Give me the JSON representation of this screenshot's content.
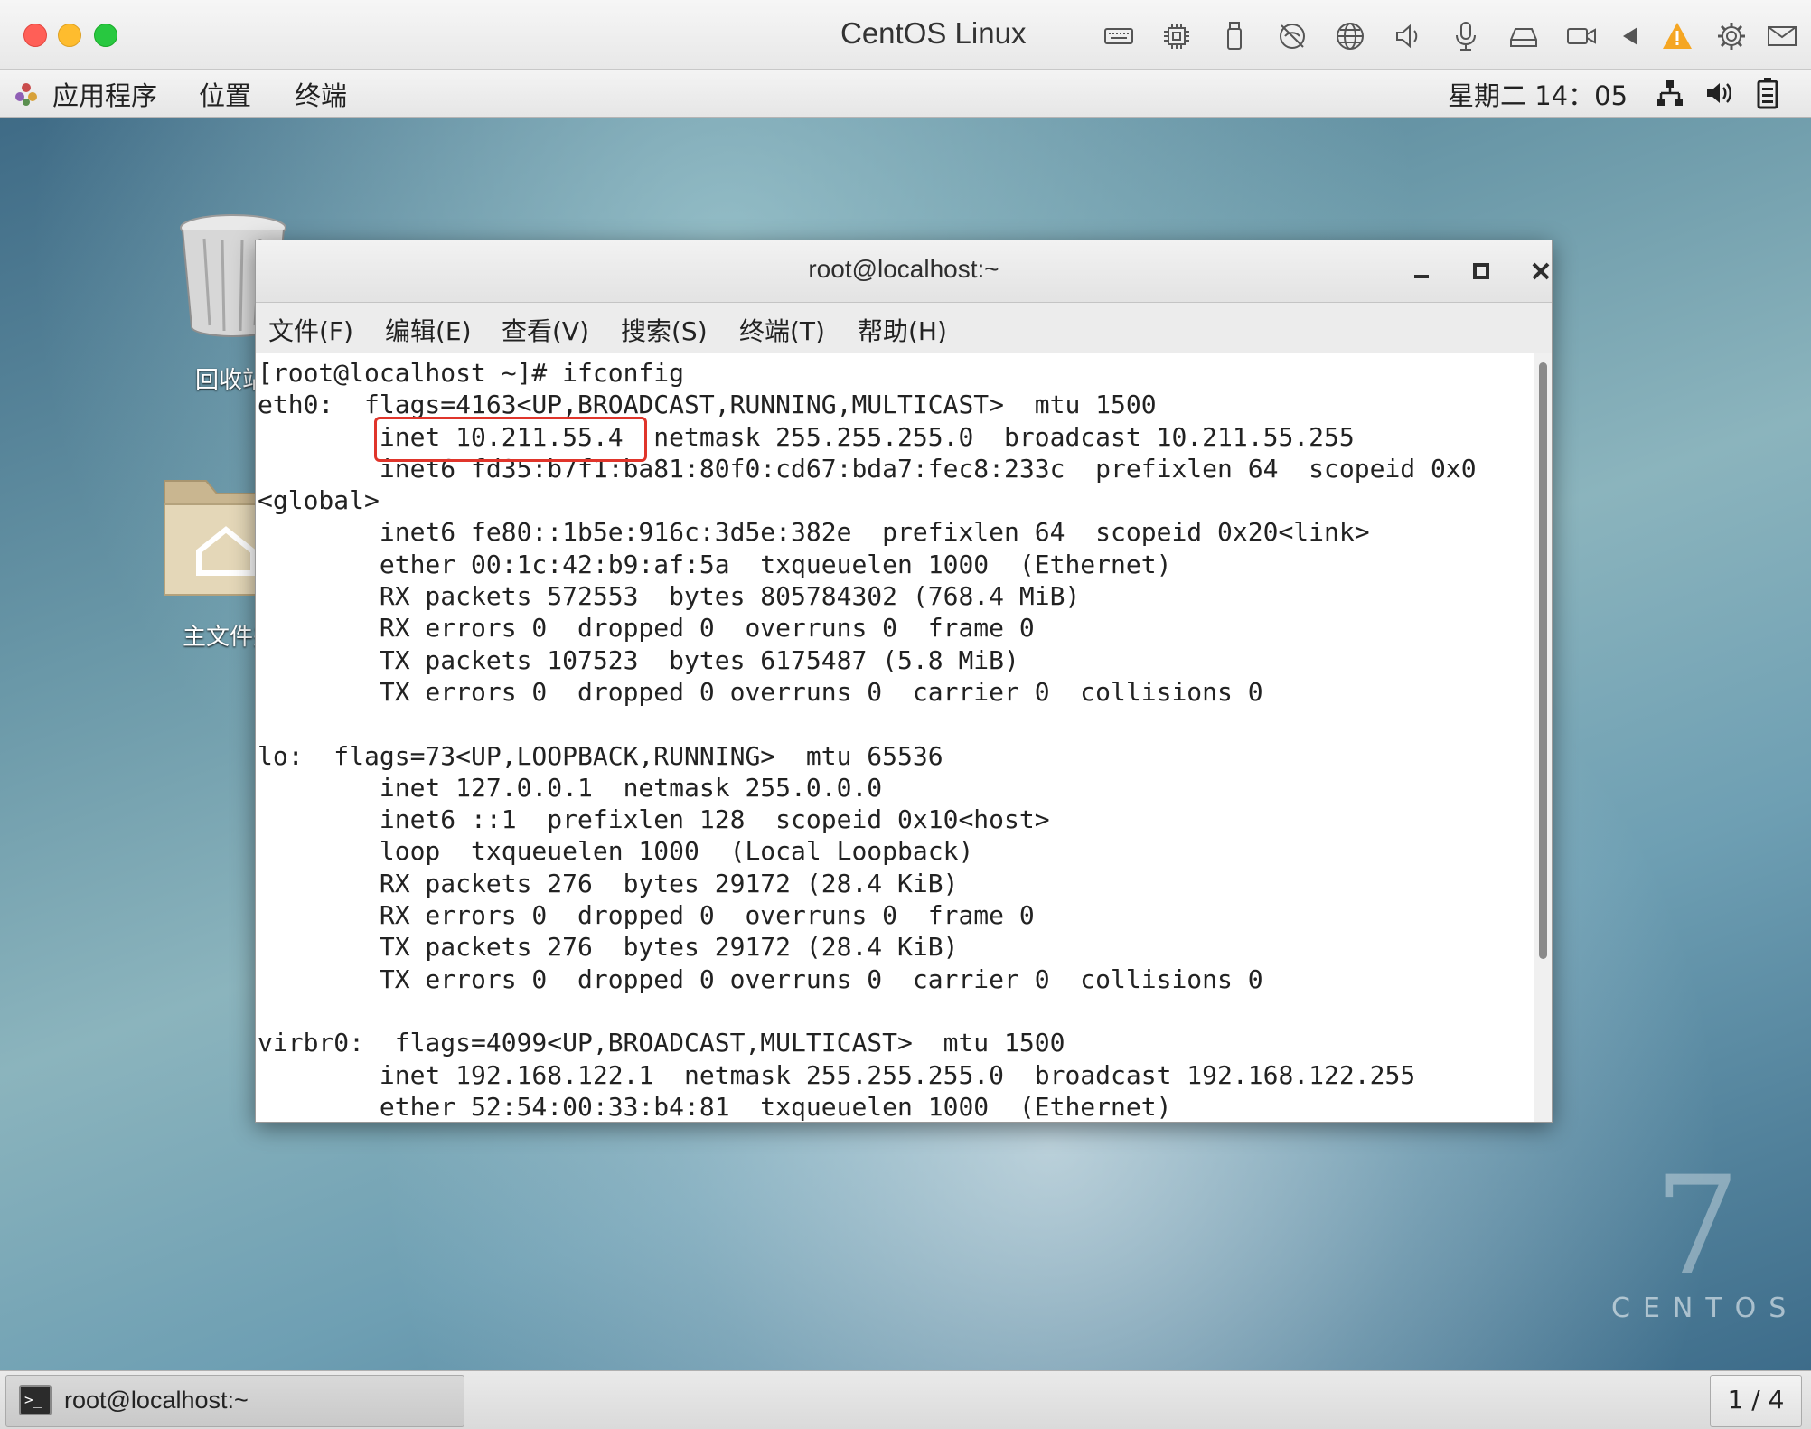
{
  "vm_window": {
    "title": "CentOS Linux",
    "toolbar_icons": [
      "keyboard-icon",
      "cpu-icon",
      "usb-icon",
      "network-disabled-icon",
      "globe-icon",
      "speaker-icon",
      "microphone-icon",
      "disk-icon",
      "camera-icon",
      "play-back-icon",
      "warning-icon",
      "gear-icon",
      "mail-icon"
    ],
    "colors": {
      "close": "#ff5f57",
      "minimize": "#febc2e",
      "maximize": "#28c840",
      "warning": "#f5a623"
    }
  },
  "gnome_panel": {
    "menus": [
      "应用程序",
      "位置",
      "终端"
    ],
    "clock": "星期二 14：05",
    "tray_icons": [
      "network-icon",
      "volume-icon",
      "battery-icon"
    ]
  },
  "desktop": {
    "icons": [
      {
        "label": "回收站"
      },
      {
        "label": "主文件夹"
      }
    ],
    "watermark_number": "7",
    "watermark_word": "CENTOS"
  },
  "terminal": {
    "title": "root@localhost:~",
    "menu": [
      "文件(F)",
      "编辑(E)",
      "查看(V)",
      "搜索(S)",
      "终端(T)",
      "帮助(H)"
    ],
    "highlight_color": "#e0352b",
    "lines": [
      "[root@localhost ~]# ifconfig",
      "eth0:  flags=4163<UP,BROADCAST,RUNNING,MULTICAST>  mtu 1500",
      "        inet 10.211.55.4  netmask 255.255.255.0  broadcast 10.211.55.255",
      "        inet6 fd35:b7f1:ba81:80f0:cd67:bda7:fec8:233c  prefixlen 64  scopeid 0x0",
      "<global>",
      "        inet6 fe80::1b5e:916c:3d5e:382e  prefixlen 64  scopeid 0x20<link>",
      "        ether 00:1c:42:b9:af:5a  txqueuelen 1000  (Ethernet)",
      "        RX packets 572553  bytes 805784302 (768.4 MiB)",
      "        RX errors 0  dropped 0  overruns 0  frame 0",
      "        TX packets 107523  bytes 6175487 (5.8 MiB)",
      "        TX errors 0  dropped 0 overruns 0  carrier 0  collisions 0",
      "",
      "lo:  flags=73<UP,LOOPBACK,RUNNING>  mtu 65536",
      "        inet 127.0.0.1  netmask 255.0.0.0",
      "        inet6 ::1  prefixlen 128  scopeid 0x10<host>",
      "        loop  txqueuelen 1000  (Local Loopback)",
      "        RX packets 276  bytes 29172 (28.4 KiB)",
      "        RX errors 0  dropped 0  overruns 0  frame 0",
      "        TX packets 276  bytes 29172 (28.4 KiB)",
      "        TX errors 0  dropped 0 overruns 0  carrier 0  collisions 0",
      "",
      "virbr0:  flags=4099<UP,BROADCAST,MULTICAST>  mtu 1500",
      "        inet 192.168.122.1  netmask 255.255.255.0  broadcast 192.168.122.255",
      "        ether 52:54:00:33:b4:81  txqueuelen 1000  (Ethernet)"
    ]
  },
  "taskbar": {
    "task_label": "root@localhost:~",
    "workspace": "1 / 4"
  }
}
